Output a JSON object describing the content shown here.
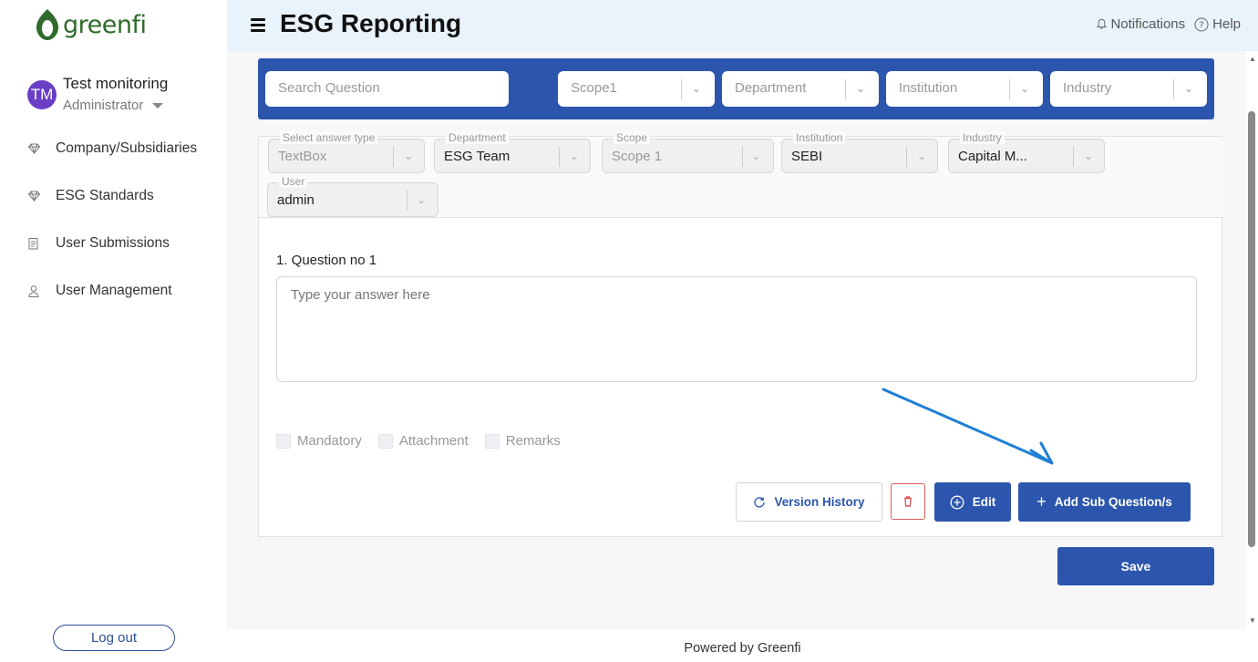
{
  "brand": {
    "name": "greenfi"
  },
  "user": {
    "initials": "TM",
    "name": "Test monitoring",
    "role": "Administrator"
  },
  "sidebar": {
    "items": [
      {
        "label": "Company/Subsidiaries",
        "icon": "diamond-icon"
      },
      {
        "label": "ESG Standards",
        "icon": "diamond-icon"
      },
      {
        "label": "User Submissions",
        "icon": "document-icon"
      },
      {
        "label": "User Management",
        "icon": "person-icon"
      }
    ],
    "logout_label": "Log out"
  },
  "header": {
    "title": "ESG Reporting",
    "notifications_label": "Notifications",
    "help_label": "Help"
  },
  "filters": {
    "search_placeholder": "Search Question",
    "scope": "Scope1",
    "department": "Department",
    "institution": "Institution",
    "industry": "Industry"
  },
  "question": {
    "answer_type": {
      "label": "Select answer type",
      "value": "TextBox"
    },
    "department": {
      "label": "Department",
      "value": "ESG Team"
    },
    "scope": {
      "label": "Scope",
      "value": "Scope 1"
    },
    "institution": {
      "label": "Institution",
      "value": "SEBI"
    },
    "industry": {
      "label": "Industry",
      "value": "Capital M..."
    },
    "user": {
      "label": "User",
      "value": "admin"
    },
    "title": "1. Question no 1",
    "answer_placeholder": "Type your answer here",
    "options": [
      "Mandatory",
      "Attachment",
      "Remarks"
    ],
    "buttons": {
      "version_history": "Version History",
      "edit": "Edit",
      "add_sub": "Add Sub Question/s"
    }
  },
  "save_label": "Save",
  "footer": "Powered by Greenfi",
  "colors": {
    "primary": "#2c56ad",
    "brand_green": "#2f6b2c",
    "avatar": "#6a3fc6",
    "arrow": "#1f7fd6",
    "delete": "#e05a5a"
  }
}
